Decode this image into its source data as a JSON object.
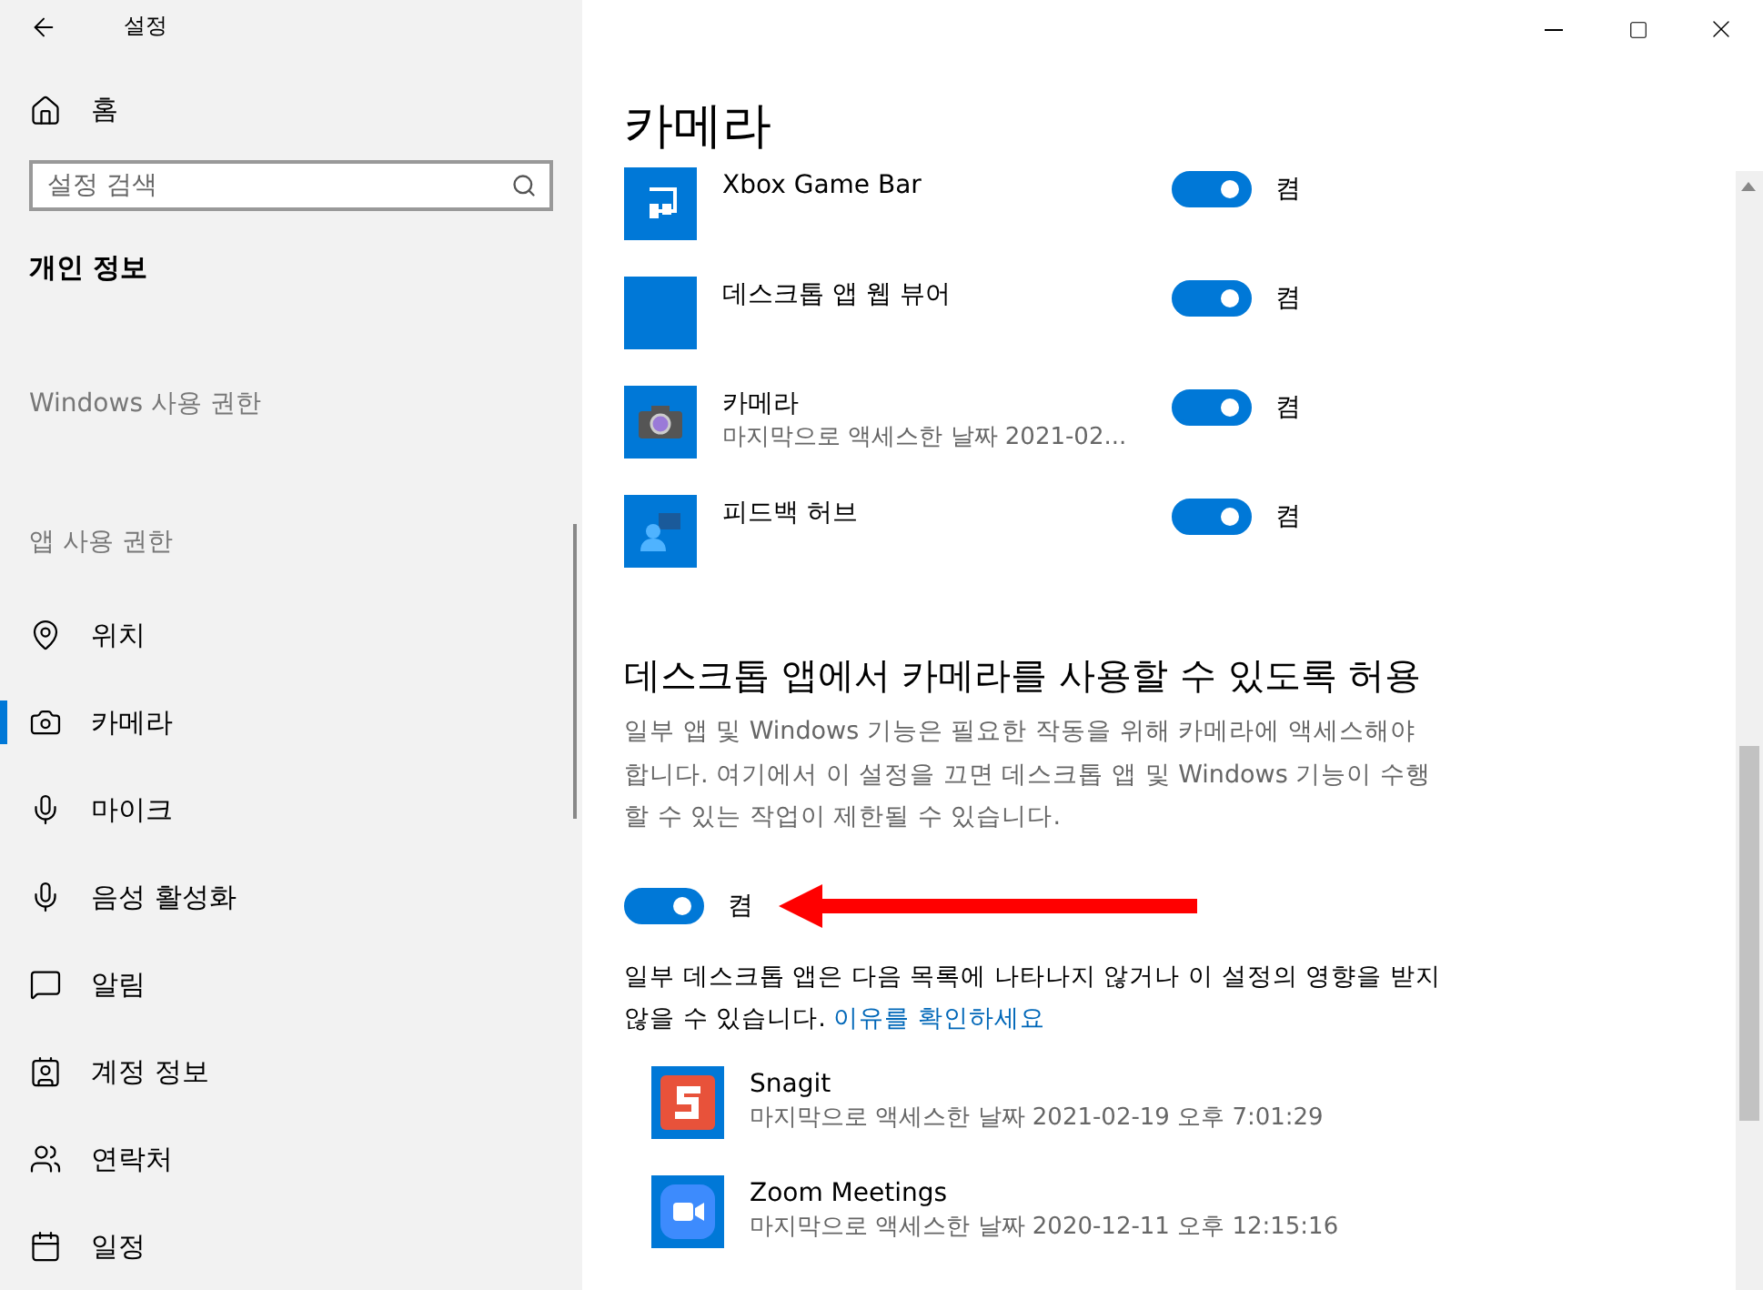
{
  "window": {
    "title": "설정"
  },
  "sidebar": {
    "home": "홈",
    "search": {
      "placeholder": "설정 검색"
    },
    "section_title": "개인 정보",
    "groups": [
      {
        "label": "Windows 사용 권한"
      },
      {
        "label": "앱 사용 권한"
      }
    ],
    "items": [
      {
        "label": "위치",
        "selected": false
      },
      {
        "label": "카메라",
        "selected": true
      },
      {
        "label": "마이크",
        "selected": false
      },
      {
        "label": "음성 활성화",
        "selected": false
      },
      {
        "label": "알림",
        "selected": false
      },
      {
        "label": "계정 정보",
        "selected": false
      },
      {
        "label": "연락처",
        "selected": false
      },
      {
        "label": "일정",
        "selected": false
      }
    ]
  },
  "page_title": "카메라",
  "apps": [
    {
      "name": "Xbox Game Bar",
      "on": true,
      "state_label": "켬"
    },
    {
      "name": "데스크톱 앱 웹 뷰어",
      "on": true,
      "state_label": "켬"
    },
    {
      "name": "카메라",
      "detail": "마지막으로 액세스한 날짜 2021-02...",
      "on": true,
      "state_label": "켬"
    },
    {
      "name": "피드백 허브",
      "on": true,
      "state_label": "켬"
    }
  ],
  "desktop_section": {
    "heading": "데스크톱 앱에서 카메라를 사용할 수 있도록 허용",
    "description": "일부 앱 및 Windows 기능은 필요한 작동을 위해 카메라에 액세스해야 합니다. 여기에서 이 설정을 끄면 데스크톱 앱 및 Windows 기능이 수행할 수 있는 작업이 제한될 수 있습니다.",
    "toggle": {
      "on": true,
      "label": "켬"
    },
    "note": "일부 데스크톱 앱은 다음 목록에 나타나지 않거나 이 설정의 영향을 받지 않을 수 있습니다.",
    "link": "이유를 확인하세요",
    "apps": [
      {
        "name": "Snagit",
        "detail": "마지막으로 액세스한 날짜 2021-02-19 오후 7:01:29"
      },
      {
        "name": "Zoom Meetings",
        "detail": "마지막으로 액세스한 날짜 2020-12-11 오후 12:15:16"
      }
    ]
  }
}
